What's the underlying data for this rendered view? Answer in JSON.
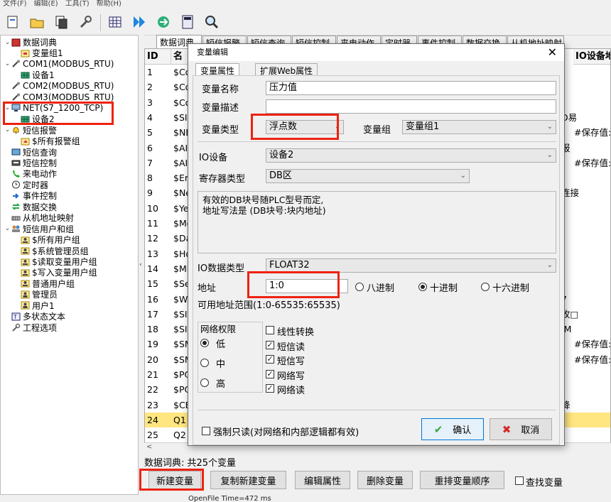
{
  "menu": [
    "文件(F)",
    "编辑(E)",
    "工具(T)",
    "帮助(H)"
  ],
  "toolbar_icons": [
    "new-icon",
    "open-icon",
    "copy-icon",
    "wrench-icon",
    "grid-icon",
    "run-icon",
    "transfer-icon",
    "calculator-icon",
    "search-icon"
  ],
  "tree": [
    {
      "label": "数据词典",
      "level": 0,
      "exp": "⌄",
      "icon": "dictionary-icon"
    },
    {
      "label": "变量组1",
      "level": 1,
      "icon": "variable-group-icon"
    },
    {
      "label": "COM1(MODBUS_RTU)",
      "level": 0,
      "exp": "⌄",
      "icon": "serial-port-icon"
    },
    {
      "label": "设备1",
      "level": 1,
      "icon": "device-icon"
    },
    {
      "label": "COM2(MODBUS_RTU)",
      "level": 0,
      "icon": "serial-port-icon"
    },
    {
      "label": "COM3(MODBUS_RTU)",
      "level": 0,
      "icon": "serial-port-icon"
    },
    {
      "label": "NET(S7_1200_TCP)",
      "level": 0,
      "exp": "⌄",
      "icon": "network-icon"
    },
    {
      "label": "设备2",
      "level": 1,
      "icon": "device-icon"
    },
    {
      "label": "短信报警",
      "level": 0,
      "exp": "⌄",
      "icon": "bell-icon"
    },
    {
      "label": "$所有报警组",
      "level": 1,
      "icon": "alarm-group-icon"
    },
    {
      "label": "短信查询",
      "level": 0,
      "icon": "sms-query-icon"
    },
    {
      "label": "短信控制",
      "level": 0,
      "icon": "sms-control-icon"
    },
    {
      "label": "来电动作",
      "level": 0,
      "icon": "phone-icon"
    },
    {
      "label": "定时器",
      "level": 0,
      "icon": "timer-icon"
    },
    {
      "label": "事件控制",
      "level": 0,
      "icon": "event-icon"
    },
    {
      "label": "数据交换",
      "level": 0,
      "icon": "exchange-icon"
    },
    {
      "label": "从机地址映射",
      "level": 0,
      "icon": "mapping-icon"
    },
    {
      "label": "短信用户和组",
      "level": 0,
      "exp": "⌄",
      "icon": "users-icon"
    },
    {
      "label": "$所有用户组",
      "level": 1,
      "icon": "user-group-icon"
    },
    {
      "label": "$系统管理员组",
      "level": 1,
      "icon": "user-group-icon"
    },
    {
      "label": "$读取变量用户组",
      "level": 1,
      "icon": "user-group-icon"
    },
    {
      "label": "$写入变量用户组",
      "level": 1,
      "icon": "user-group-icon"
    },
    {
      "label": "普通用户组",
      "level": 1,
      "icon": "user-group-icon"
    },
    {
      "label": "管理员",
      "level": 1,
      "icon": "user-icon"
    },
    {
      "label": "用户1",
      "level": 1,
      "icon": "user-icon"
    },
    {
      "label": "多状态文本",
      "level": 0,
      "icon": "text-icon"
    },
    {
      "label": "工程选项",
      "level": 0,
      "icon": "settings-icon"
    }
  ],
  "tabs": [
    "数据词典",
    "短信报警",
    "短信查询",
    "短信控制",
    "来电动作",
    "定时器",
    "事件控制",
    "数据交换",
    "从机地址映射"
  ],
  "grid": {
    "headers": [
      "ID",
      "名",
      "IO设备地"
    ],
    "rows": [
      {
        "id": "1",
        "name": "$Co",
        "r1": "",
        "r2": ""
      },
      {
        "id": "2",
        "name": "$Co",
        "r1": "",
        "r2": ""
      },
      {
        "id": "3",
        "name": "$Co",
        "r1": "",
        "r2": ""
      },
      {
        "id": "4",
        "name": "$SI",
        "r1": "D易",
        "r2": ""
      },
      {
        "id": "5",
        "name": "$NE",
        "r1": "",
        "r2": "#保存值:"
      },
      {
        "id": "6",
        "name": "$AI",
        "r1": "报",
        "r2": ""
      },
      {
        "id": "7",
        "name": "$AI",
        "r1": "",
        "r2": "#保存值:"
      },
      {
        "id": "8",
        "name": "$Er",
        "r1": "",
        "r2": ""
      },
      {
        "id": "9",
        "name": "$Ne",
        "r1": "连接",
        "r2": ""
      },
      {
        "id": "10",
        "name": "$Ye",
        "r1": "",
        "r2": ""
      },
      {
        "id": "11",
        "name": "$Mo",
        "r1": "",
        "r2": ""
      },
      {
        "id": "12",
        "name": "$Da",
        "r1": "",
        "r2": ""
      },
      {
        "id": "13",
        "name": "$Ho",
        "r1": "",
        "r2": ""
      },
      {
        "id": "14",
        "name": "$Mi",
        "r1": "",
        "r2": ""
      },
      {
        "id": "15",
        "name": "$Se",
        "r1": "",
        "r2": ""
      },
      {
        "id": "16",
        "name": "$We",
        "r1": "7",
        "r2": ""
      },
      {
        "id": "17",
        "name": "$SI",
        "r1": "攻□",
        "r2": ""
      },
      {
        "id": "18",
        "name": "$SI",
        "r1": "IM",
        "r2": ""
      },
      {
        "id": "19",
        "name": "$SM",
        "r1": "",
        "r2": "#保存值:"
      },
      {
        "id": "20",
        "name": "$SM",
        "r1": "",
        "r2": "#保存值:"
      },
      {
        "id": "21",
        "name": "$PO",
        "r1": "",
        "r2": ""
      },
      {
        "id": "22",
        "name": "$PO",
        "r1": "",
        "r2": ""
      },
      {
        "id": "23",
        "name": "$CE",
        "r1": "降",
        "r2": ""
      },
      {
        "id": "24",
        "name": "Q1",
        "r1": "",
        "r2": ""
      },
      {
        "id": "25",
        "name": "Q2",
        "r1": "",
        "r2": ""
      }
    ],
    "selected_id": "24"
  },
  "status_text": "数据词典: 共25个变量",
  "bottom_buttons": [
    "新建变量",
    "复制新建变量",
    "编辑属性",
    "删除变量",
    "重排变量顺序"
  ],
  "find_var_label": "查找变量",
  "log_text": "OpenFile Time=472 ms",
  "dialog": {
    "title": "变量编辑",
    "tabs": [
      "变量属性",
      "扩展Web属性"
    ],
    "var_name_label": "变量名称",
    "var_name": "压力值",
    "var_desc_label": "变量描述",
    "var_desc": "",
    "var_type_label": "变量类型",
    "var_type": "浮点数",
    "var_group_label": "变量组",
    "var_group": "变量组1",
    "io_device_label": "IO设备",
    "io_device": "设备2",
    "reg_type_label": "寄存器类型",
    "reg_type": "DB区",
    "note": "有效的DB块号随PLC型号而定,\n地址写法是 (DB块号:块内地址)",
    "io_data_type_label": "IO数据类型",
    "io_data_type": "FLOAT32",
    "address_label": "地址",
    "address": "1:0",
    "radix_options": [
      "八进制",
      "十进制",
      "十六进制"
    ],
    "radix_selected": 1,
    "range_text": "可用地址范围(1:0-65535:65535)",
    "net_perm_label": "网络权限",
    "net_perm_options": [
      "低",
      "中",
      "高"
    ],
    "net_perm_selected": 0,
    "checkboxes": [
      {
        "label": "线性转换",
        "checked": false
      },
      {
        "label": "短信读",
        "checked": true
      },
      {
        "label": "短信写",
        "checked": true
      },
      {
        "label": "网络写",
        "checked": true
      },
      {
        "label": "网络读",
        "checked": true
      }
    ],
    "force_readonly_label": "强制只读(对网络和内部逻辑都有效)",
    "ok_label": "确认",
    "cancel_label": "取消"
  },
  "colors": {
    "highlight_red": "#e21111",
    "selected_row": "#ffe680",
    "ok_green": "#3aa53a",
    "cancel_red": "#d42a2a"
  }
}
